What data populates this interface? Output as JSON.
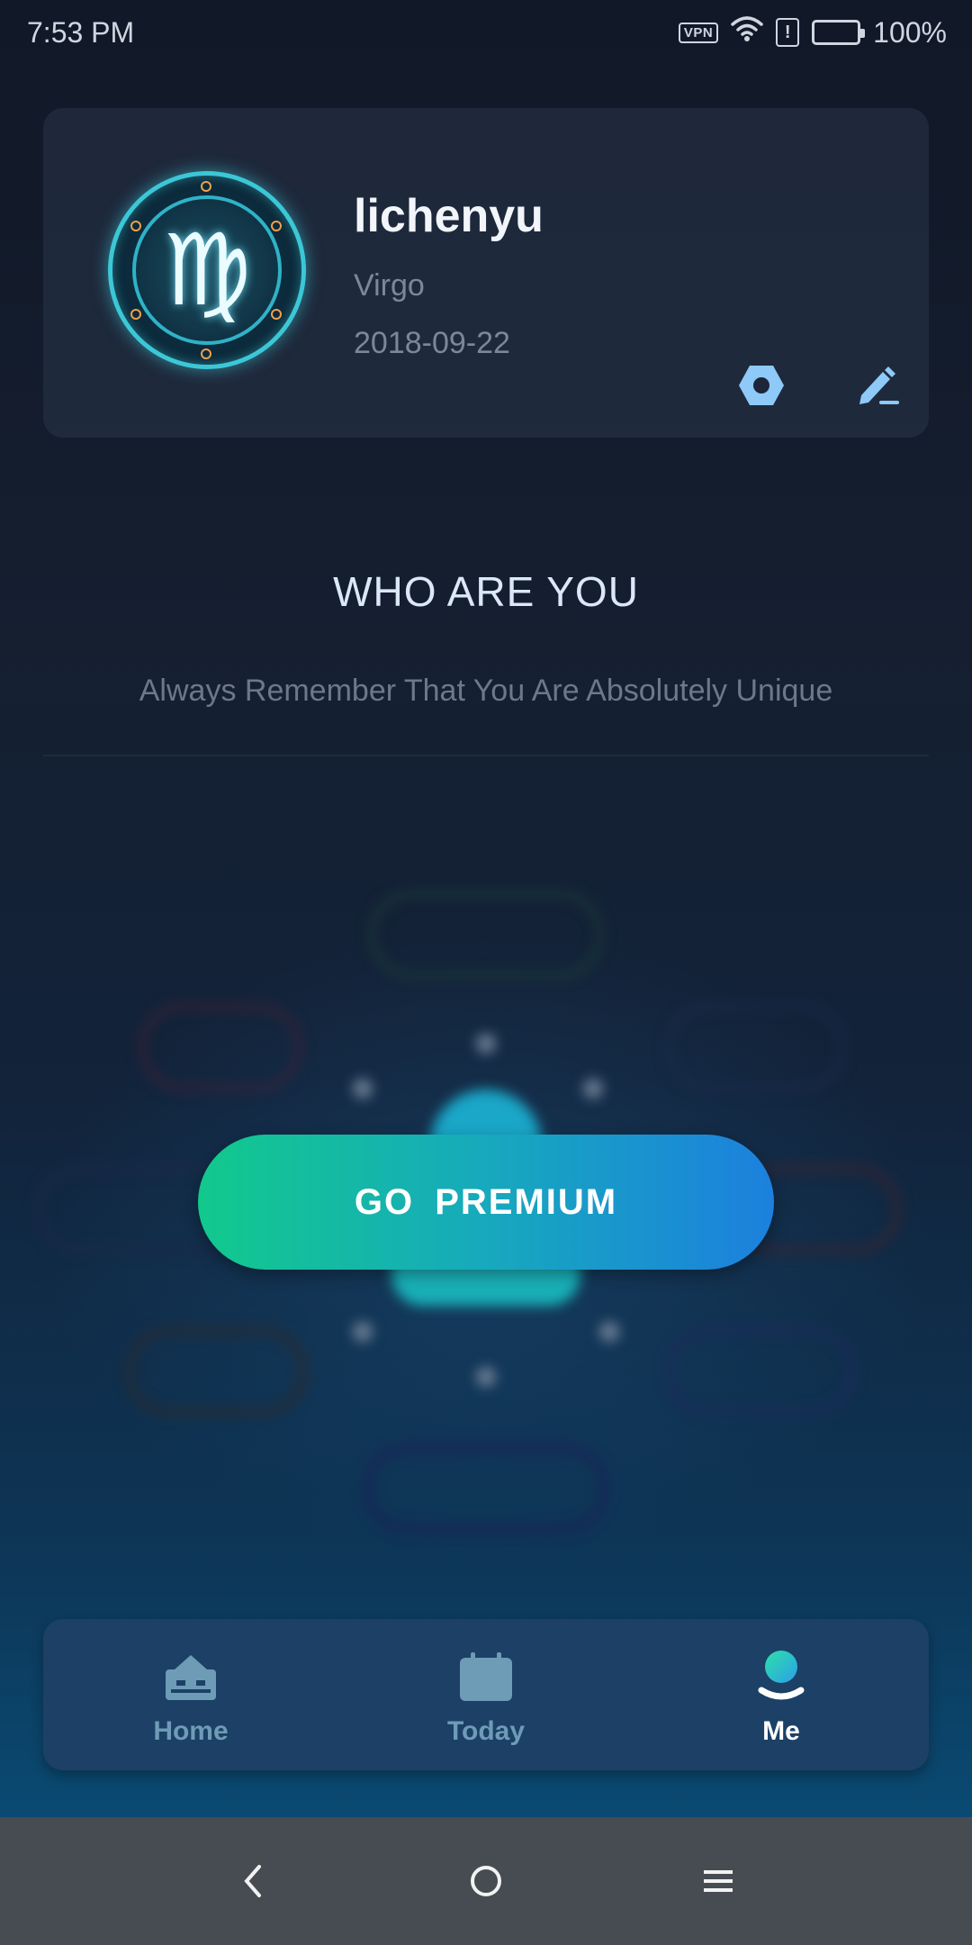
{
  "status_bar": {
    "time": "7:53 PM",
    "vpn": "VPN",
    "alert": "!",
    "battery": "100%"
  },
  "profile": {
    "name": "lichenyu",
    "sign": "Virgo",
    "date": "2018-09-22",
    "sign_glyph": "♍"
  },
  "section": {
    "title": "WHO ARE YOU",
    "subtitle": "Always Remember That You Are Absolutely Unique"
  },
  "premium": {
    "label": "GO  PREMIUM"
  },
  "tabs": [
    {
      "label": "Home",
      "icon": "home-icon",
      "active": false
    },
    {
      "label": "Today",
      "icon": "calendar-icon",
      "active": false
    },
    {
      "label": "Me",
      "icon": "person-icon",
      "active": true
    }
  ],
  "colors": {
    "accent_green": "#12c98c",
    "accent_blue": "#1c80de",
    "tab_inactive": "#6e9bb5"
  }
}
